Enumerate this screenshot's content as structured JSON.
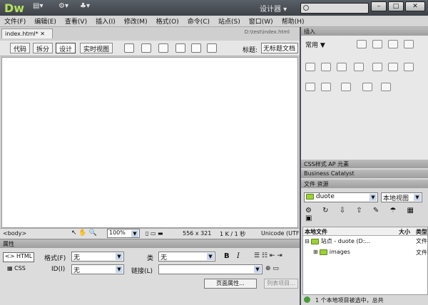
{
  "app": {
    "logo": "Dw",
    "designer": "设计器",
    "search_placeholder": ""
  },
  "menu": [
    "文件(F)",
    "编辑(E)",
    "查看(V)",
    "插入(I)",
    "修改(M)",
    "格式(O)",
    "命令(C)",
    "站点(S)",
    "窗口(W)",
    "帮助(H)"
  ],
  "document": {
    "tab": "index.html*",
    "path": "D:\\test\\index.html",
    "views": [
      "代码",
      "拆分",
      "设计",
      "实时视图"
    ],
    "title_label": "标题:",
    "title_value": "无标题文档"
  },
  "statusbar": {
    "tag": "<body>",
    "zoom": "100%",
    "size": "556 x 321",
    "weight": "1 K / 1 秒",
    "encoding": "Unicode (UTF"
  },
  "properties": {
    "title": "属性",
    "html_btn": "HTML",
    "css_btn": "CSS",
    "format_label": "格式(F)",
    "format_value": "无",
    "id_label": "ID(I)",
    "id_value": "无",
    "class_label": "类",
    "class_value": "无",
    "link_label": "链接(L)",
    "page_props": "页面属性...",
    "list_item": "列表项目..."
  },
  "insert_panel": {
    "title": "插入",
    "category": "常用"
  },
  "panels": {
    "css_tabs": [
      "CSS样式",
      "AP 元素"
    ],
    "bc": "Business Catalyst",
    "file_tabs": [
      "文件",
      "资源"
    ],
    "site": "duote",
    "view": "本地视图"
  },
  "files": {
    "col_local": "本地文件",
    "col_size": "大小",
    "col_type": "类型",
    "site_row": "站点 - duote (D:...",
    "site_type": "文件",
    "images": "images",
    "images_type": "文件",
    "bottom": "1 个本地项目被选中，总共"
  }
}
